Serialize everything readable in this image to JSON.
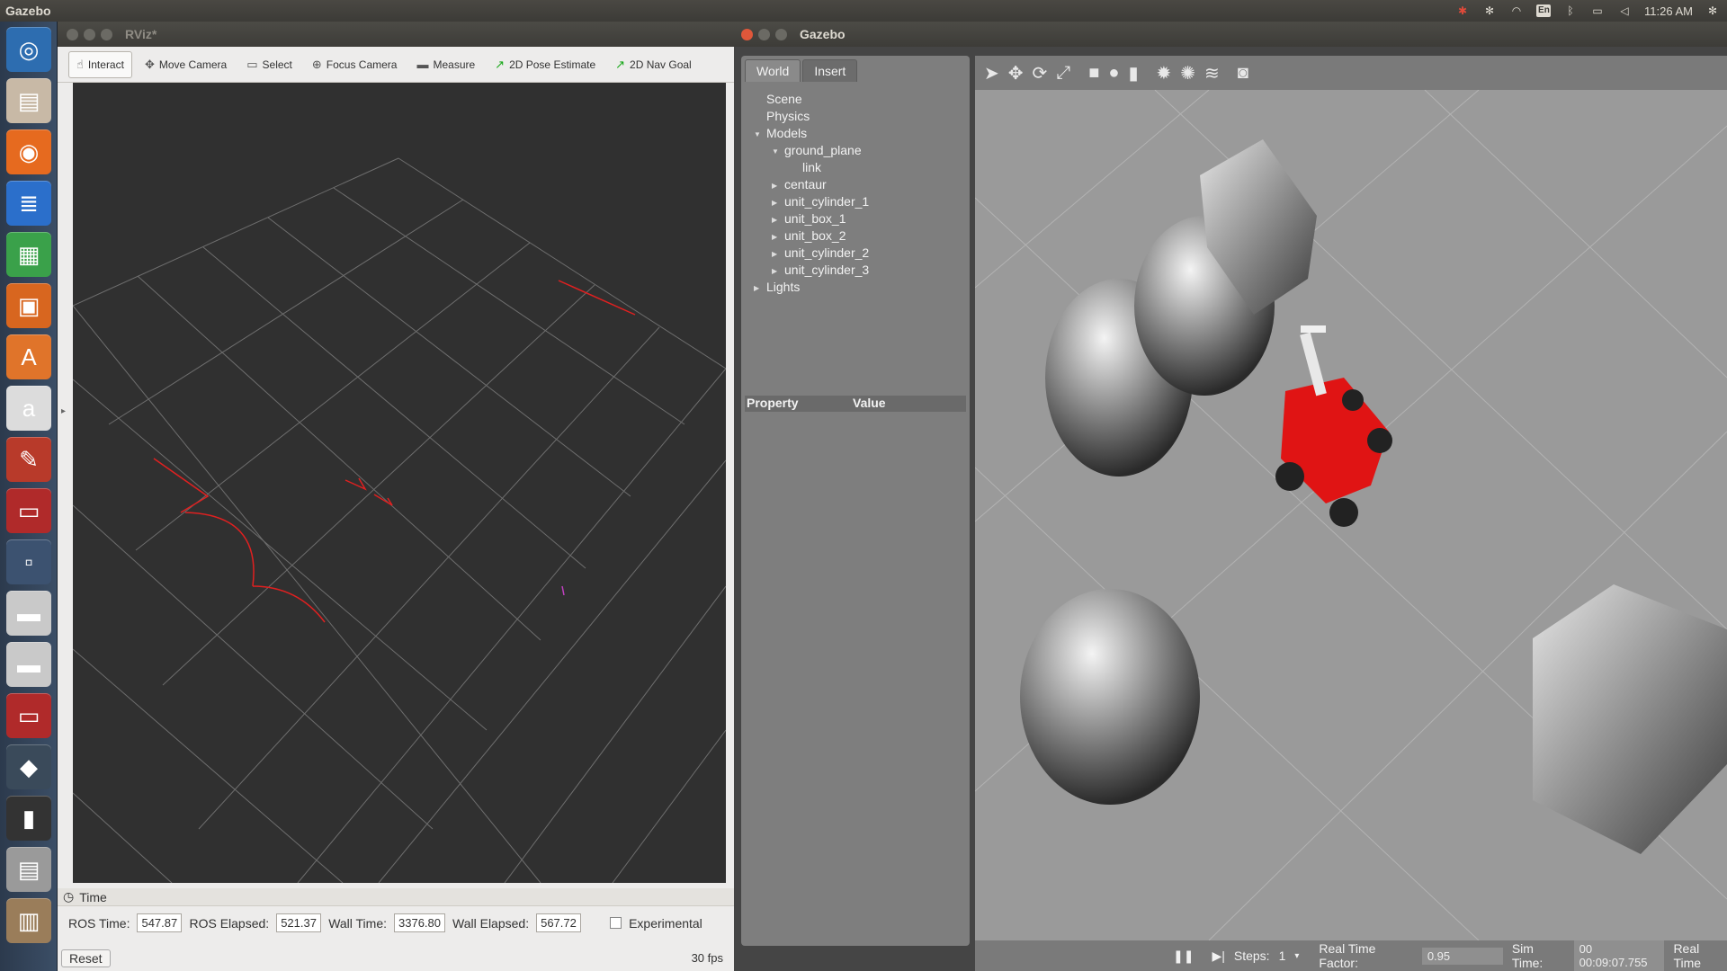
{
  "topbar": {
    "app_name": "Gazebo",
    "language": "En",
    "clock": "11:26 AM"
  },
  "launcher": {
    "items": [
      {
        "name": "ubuntu-dash-icon",
        "glyph": "◎",
        "color": "#2d6db0"
      },
      {
        "name": "files-icon",
        "glyph": "▤",
        "color": "#c8b9a6"
      },
      {
        "name": "firefox-icon",
        "glyph": "◉",
        "color": "#e66a1f"
      },
      {
        "name": "writer-icon",
        "glyph": "≣",
        "color": "#2b6fcb"
      },
      {
        "name": "calc-icon",
        "glyph": "▦",
        "color": "#3aa14a"
      },
      {
        "name": "impress-icon",
        "glyph": "▣",
        "color": "#d8661f"
      },
      {
        "name": "software-center-icon",
        "glyph": "A",
        "color": "#e0742a"
      },
      {
        "name": "amazon-icon",
        "glyph": "a",
        "color": "#dcdcdc"
      },
      {
        "name": "settings-icon",
        "glyph": "✎",
        "color": "#b83a2a"
      },
      {
        "name": "rviz-app-icon",
        "glyph": "▭",
        "color": "#b02a2a"
      },
      {
        "name": "workspace-switcher-icon",
        "glyph": "▫",
        "color": "#3c5270"
      },
      {
        "name": "disk-icon",
        "glyph": "▬",
        "color": "#c9c9c9"
      },
      {
        "name": "disk-2-icon",
        "glyph": "▬",
        "color": "#c9c9c9"
      },
      {
        "name": "rviz-app-2-icon",
        "glyph": "▭",
        "color": "#b02a2a"
      },
      {
        "name": "gazebo-app-icon",
        "glyph": "◆",
        "color": "#3a4a5a"
      },
      {
        "name": "terminal-icon",
        "glyph": "▮",
        "color": "#333333"
      },
      {
        "name": "scanner-icon",
        "glyph": "▤",
        "color": "#9a9a9a"
      },
      {
        "name": "trash-icon",
        "glyph": "▥",
        "color": "#9a7d5a"
      }
    ]
  },
  "rviz": {
    "title": "RViz*",
    "tools": [
      {
        "label": "Interact",
        "icon": "hand-icon",
        "glyph": "☝",
        "active": true
      },
      {
        "label": "Move Camera",
        "icon": "move-camera-icon",
        "glyph": "✥",
        "active": false
      },
      {
        "label": "Select",
        "icon": "select-icon",
        "glyph": "▭",
        "active": false
      },
      {
        "label": "Focus Camera",
        "icon": "focus-camera-icon",
        "glyph": "⊕",
        "active": false
      },
      {
        "label": "Measure",
        "icon": "measure-icon",
        "glyph": "▬",
        "active": false
      },
      {
        "label": "2D Pose Estimate",
        "icon": "pose-estimate-icon",
        "glyph": "↗",
        "active": false
      },
      {
        "label": "2D Nav Goal",
        "icon": "nav-goal-icon",
        "glyph": "↗",
        "active": false
      }
    ],
    "time_panel": {
      "title": "Time",
      "ros_time_label": "ROS Time:",
      "ros_time": "547.87",
      "ros_elapsed_label": "ROS Elapsed:",
      "ros_elapsed": "521.37",
      "wall_time_label": "Wall Time:",
      "wall_time": "3376.80",
      "wall_elapsed_label": "Wall Elapsed:",
      "wall_elapsed": "567.72",
      "experimental_label": "Experimental",
      "reset_label": "Reset",
      "fps": "30 fps"
    }
  },
  "gazebo": {
    "title": "Gazebo",
    "tabs": [
      "World",
      "Insert"
    ],
    "tree": {
      "scene": "Scene",
      "physics": "Physics",
      "models": "Models",
      "ground_plane": "ground_plane",
      "link": "link",
      "model_items": [
        "centaur",
        "unit_cylinder_1",
        "unit_box_1",
        "unit_box_2",
        "unit_cylinder_2",
        "unit_cylinder_3"
      ],
      "lights": "Lights"
    },
    "property_header": "Property",
    "value_header": "Value",
    "bottom": {
      "steps_label": "Steps:",
      "steps": "1",
      "rtf_label": "Real Time Factor:",
      "rtf": "0.95",
      "sim_time_label": "Sim Time:",
      "sim_time": "00 00:09:07.755",
      "real_time_label": "Real Time"
    }
  }
}
